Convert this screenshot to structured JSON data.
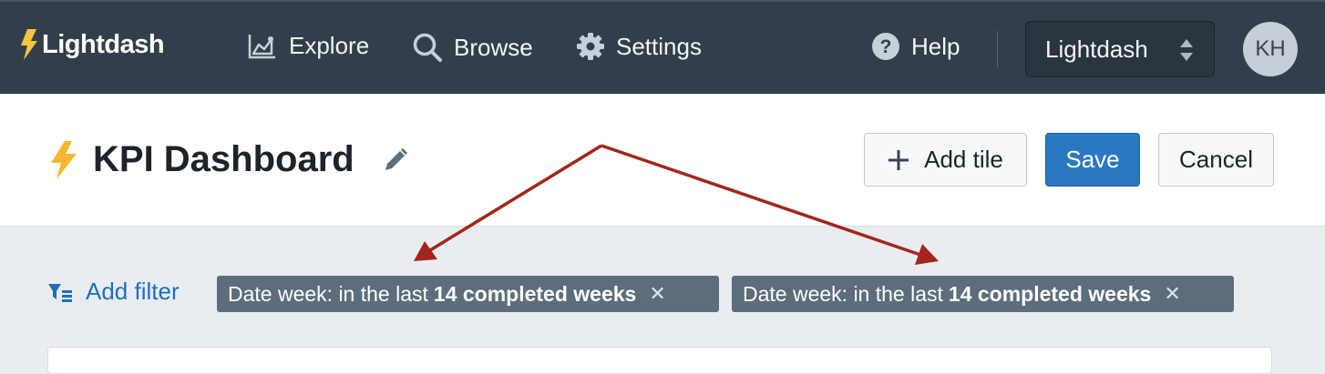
{
  "navbar": {
    "brand": "Lightdash",
    "items": [
      {
        "label": "Explore",
        "icon": "area-chart-icon"
      },
      {
        "label": "Browse",
        "icon": "search-icon"
      },
      {
        "label": "Settings",
        "icon": "gear-icon"
      }
    ],
    "help_label": "Help",
    "project": "Lightdash",
    "avatar_initials": "KH"
  },
  "dashboard": {
    "title": "KPI Dashboard",
    "add_tile_label": "Add tile",
    "save_label": "Save",
    "cancel_label": "Cancel"
  },
  "filters": {
    "add_label": "Add filter",
    "chips": [
      {
        "prefix": "Date week: in the last",
        "bold": "14 completed weeks"
      },
      {
        "prefix": "Date week: in the last",
        "bold": "14 completed weeks"
      }
    ]
  },
  "colors": {
    "navbar": "#323f4b",
    "accent_blue": "#2b78c2",
    "chip": "#5c6d7c",
    "annotation_arrow": "#a3261b",
    "bolt": "#f5b730"
  }
}
